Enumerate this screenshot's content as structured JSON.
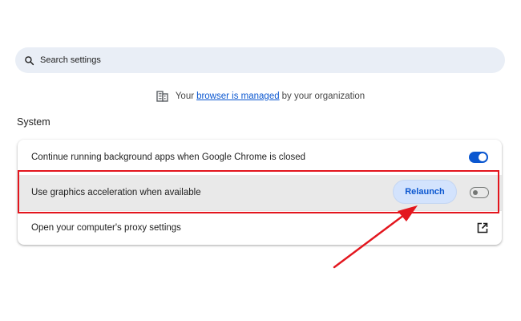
{
  "search": {
    "placeholder": "Search settings",
    "icon": "search-icon"
  },
  "managed_notice": {
    "icon": "building-icon",
    "prefix": "Your",
    "link": "browser is managed",
    "suffix": "by your organization"
  },
  "section": {
    "title": "System"
  },
  "settings": {
    "background_apps": {
      "label": "Continue running background apps when Google Chrome is closed",
      "enabled": true
    },
    "graphics_acceleration": {
      "label": "Use graphics acceleration when available",
      "enabled": false,
      "relaunch_label": "Relaunch"
    },
    "proxy": {
      "label": "Open your computer's proxy settings",
      "icon": "external-link-icon"
    }
  },
  "annotation": {
    "color": "#e3161e"
  },
  "colors": {
    "accent": "#0b57d0",
    "search_bg": "#e9eef6",
    "relaunch_bg": "#d3e3fd",
    "highlight_row_bg": "#e9e9e9"
  }
}
